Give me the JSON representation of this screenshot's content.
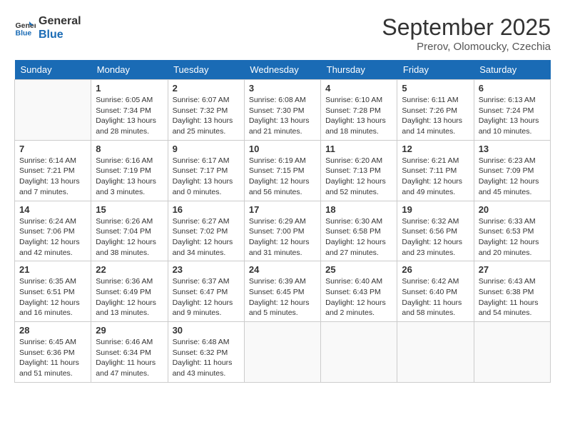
{
  "logo": {
    "line1": "General",
    "line2": "Blue"
  },
  "title": "September 2025",
  "subtitle": "Prerov, Olomoucky, Czechia",
  "weekdays": [
    "Sunday",
    "Monday",
    "Tuesday",
    "Wednesday",
    "Thursday",
    "Friday",
    "Saturday"
  ],
  "weeks": [
    [
      {
        "day": "",
        "info": ""
      },
      {
        "day": "1",
        "info": "Sunrise: 6:05 AM\nSunset: 7:34 PM\nDaylight: 13 hours\nand 28 minutes."
      },
      {
        "day": "2",
        "info": "Sunrise: 6:07 AM\nSunset: 7:32 PM\nDaylight: 13 hours\nand 25 minutes."
      },
      {
        "day": "3",
        "info": "Sunrise: 6:08 AM\nSunset: 7:30 PM\nDaylight: 13 hours\nand 21 minutes."
      },
      {
        "day": "4",
        "info": "Sunrise: 6:10 AM\nSunset: 7:28 PM\nDaylight: 13 hours\nand 18 minutes."
      },
      {
        "day": "5",
        "info": "Sunrise: 6:11 AM\nSunset: 7:26 PM\nDaylight: 13 hours\nand 14 minutes."
      },
      {
        "day": "6",
        "info": "Sunrise: 6:13 AM\nSunset: 7:24 PM\nDaylight: 13 hours\nand 10 minutes."
      }
    ],
    [
      {
        "day": "7",
        "info": "Sunrise: 6:14 AM\nSunset: 7:21 PM\nDaylight: 13 hours\nand 7 minutes."
      },
      {
        "day": "8",
        "info": "Sunrise: 6:16 AM\nSunset: 7:19 PM\nDaylight: 13 hours\nand 3 minutes."
      },
      {
        "day": "9",
        "info": "Sunrise: 6:17 AM\nSunset: 7:17 PM\nDaylight: 13 hours\nand 0 minutes."
      },
      {
        "day": "10",
        "info": "Sunrise: 6:19 AM\nSunset: 7:15 PM\nDaylight: 12 hours\nand 56 minutes."
      },
      {
        "day": "11",
        "info": "Sunrise: 6:20 AM\nSunset: 7:13 PM\nDaylight: 12 hours\nand 52 minutes."
      },
      {
        "day": "12",
        "info": "Sunrise: 6:21 AM\nSunset: 7:11 PM\nDaylight: 12 hours\nand 49 minutes."
      },
      {
        "day": "13",
        "info": "Sunrise: 6:23 AM\nSunset: 7:09 PM\nDaylight: 12 hours\nand 45 minutes."
      }
    ],
    [
      {
        "day": "14",
        "info": "Sunrise: 6:24 AM\nSunset: 7:06 PM\nDaylight: 12 hours\nand 42 minutes."
      },
      {
        "day": "15",
        "info": "Sunrise: 6:26 AM\nSunset: 7:04 PM\nDaylight: 12 hours\nand 38 minutes."
      },
      {
        "day": "16",
        "info": "Sunrise: 6:27 AM\nSunset: 7:02 PM\nDaylight: 12 hours\nand 34 minutes."
      },
      {
        "day": "17",
        "info": "Sunrise: 6:29 AM\nSunset: 7:00 PM\nDaylight: 12 hours\nand 31 minutes."
      },
      {
        "day": "18",
        "info": "Sunrise: 6:30 AM\nSunset: 6:58 PM\nDaylight: 12 hours\nand 27 minutes."
      },
      {
        "day": "19",
        "info": "Sunrise: 6:32 AM\nSunset: 6:56 PM\nDaylight: 12 hours\nand 23 minutes."
      },
      {
        "day": "20",
        "info": "Sunrise: 6:33 AM\nSunset: 6:53 PM\nDaylight: 12 hours\nand 20 minutes."
      }
    ],
    [
      {
        "day": "21",
        "info": "Sunrise: 6:35 AM\nSunset: 6:51 PM\nDaylight: 12 hours\nand 16 minutes."
      },
      {
        "day": "22",
        "info": "Sunrise: 6:36 AM\nSunset: 6:49 PM\nDaylight: 12 hours\nand 13 minutes."
      },
      {
        "day": "23",
        "info": "Sunrise: 6:37 AM\nSunset: 6:47 PM\nDaylight: 12 hours\nand 9 minutes."
      },
      {
        "day": "24",
        "info": "Sunrise: 6:39 AM\nSunset: 6:45 PM\nDaylight: 12 hours\nand 5 minutes."
      },
      {
        "day": "25",
        "info": "Sunrise: 6:40 AM\nSunset: 6:43 PM\nDaylight: 12 hours\nand 2 minutes."
      },
      {
        "day": "26",
        "info": "Sunrise: 6:42 AM\nSunset: 6:40 PM\nDaylight: 11 hours\nand 58 minutes."
      },
      {
        "day": "27",
        "info": "Sunrise: 6:43 AM\nSunset: 6:38 PM\nDaylight: 11 hours\nand 54 minutes."
      }
    ],
    [
      {
        "day": "28",
        "info": "Sunrise: 6:45 AM\nSunset: 6:36 PM\nDaylight: 11 hours\nand 51 minutes."
      },
      {
        "day": "29",
        "info": "Sunrise: 6:46 AM\nSunset: 6:34 PM\nDaylight: 11 hours\nand 47 minutes."
      },
      {
        "day": "30",
        "info": "Sunrise: 6:48 AM\nSunset: 6:32 PM\nDaylight: 11 hours\nand 43 minutes."
      },
      {
        "day": "",
        "info": ""
      },
      {
        "day": "",
        "info": ""
      },
      {
        "day": "",
        "info": ""
      },
      {
        "day": "",
        "info": ""
      }
    ]
  ]
}
